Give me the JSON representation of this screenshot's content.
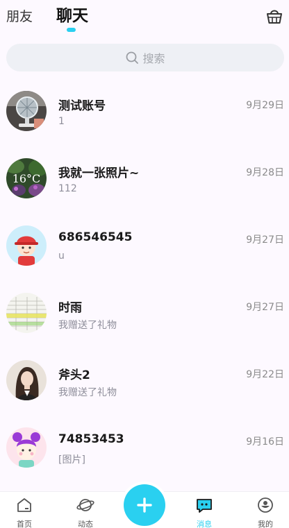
{
  "header": {
    "tab_friends": "朋友",
    "tab_chat": "聊天",
    "active_tab": "chat",
    "basket_icon": "basket-icon"
  },
  "search": {
    "placeholder": "搜索",
    "icon": "search-icon"
  },
  "chats": [
    {
      "name": "测试账号",
      "preview": "1",
      "date": "9月29日",
      "avatar": "fan-photo"
    },
    {
      "name": "我就一张照片~",
      "preview": "112",
      "date": "9月28日",
      "avatar": "temperature-photo",
      "avatar_text": "16°C"
    },
    {
      "name": "686546545",
      "preview": "u",
      "date": "9月27日",
      "avatar": "cartoon-boy-red-cap"
    },
    {
      "name": "时雨",
      "preview": "我赠送了礼物",
      "date": "9月27日",
      "avatar": "spreadsheet-photo"
    },
    {
      "name": "斧头2",
      "preview": "我赠送了礼物",
      "date": "9月22日",
      "avatar": "girl-portrait"
    },
    {
      "name": "74853453",
      "preview": "[图片]",
      "date": "9月16日",
      "avatar": "cartoon-girl-purple-hair"
    }
  ],
  "bottom_nav": {
    "items": [
      {
        "label": "首页",
        "icon": "home-icon"
      },
      {
        "label": "动态",
        "icon": "planet-icon"
      },
      {
        "label": "消息",
        "icon": "message-icon",
        "active": true
      },
      {
        "label": "我的",
        "icon": "profile-icon"
      }
    ],
    "fab_icon": "plus-icon"
  },
  "colors": {
    "accent": "#2ad0f0",
    "background": "#fdf9ff",
    "search_bg": "#eef0f5"
  }
}
